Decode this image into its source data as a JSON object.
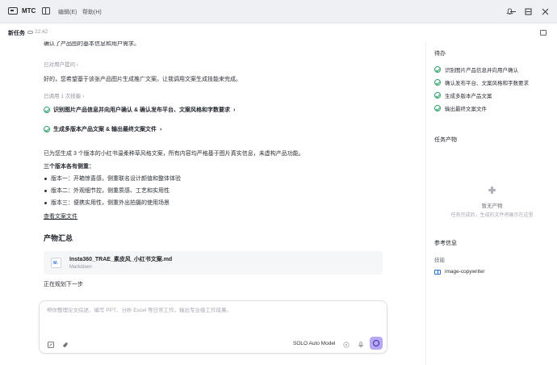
{
  "titlebar": {
    "app_name": "MTC",
    "menu_edit": "编辑(E)",
    "menu_help": "帮助(H)"
  },
  "task": {
    "title": "新任务",
    "time": "22:42"
  },
  "chat": {
    "top_cut": "确认了产品图的基本信息和用户需求。",
    "asked_user": "已对用户提问 ›",
    "reply": "好的，您希望基于该张产品图片生成推广文案。让我调用文案生成技能来完成。",
    "skills_called": "已调用 1 次技能 ›",
    "steps": [
      "识别图片产品信息并向用户确认 & 确认发布平台、文案风格和字数要求",
      "生成多版本产品文案 & 输出最终文案文件"
    ],
    "summary": "已为您生成 3 个版本的小红书温柔种草风格文案，所有内容均严格基于图片真实信息，未虚构产品功能。",
    "versions_heading": "三个版本各有侧重：",
    "versions": [
      "版本一：开箱惊喜感，侧重联名设计颜值和整体体验",
      "版本二：外观细节控，侧重质感、工艺和实用性",
      "版本三：便携实用性，侧重外出拍摄的使用场景"
    ],
    "view_copy": "查看文案文件",
    "output_heading": "产物汇总",
    "file": {
      "badge": "M↓",
      "name": "Insta360_TRAE_素皮风_小红书文案.md",
      "type": "Markdown"
    },
    "planning": "正在规划下一步"
  },
  "composer": {
    "placeholder": "帮你整理论文综述、编写 PPT、分析 Excel 等日常工作，输出专业级工作成果。",
    "model": "SOLO Auto Model"
  },
  "sidebar": {
    "todo_title": "待办",
    "todos": [
      "识别图片产品信息并向用户确认",
      "确认发布平台、文案风格和字数要求",
      "生成多版本产品文案",
      "输出最终文案文件"
    ],
    "artifacts_title": "任务产物",
    "empty_title": "暂无产物",
    "empty_sub": "任务完成后，生成的文件将展示在这里",
    "reference_title": "参考信息",
    "skills_label": "技能",
    "skill_name": "image-copywriter"
  },
  "colors": {
    "accent_green": "#2fa36b",
    "send_button": "#b7a8f5",
    "link_blue": "#2b6cd6"
  }
}
